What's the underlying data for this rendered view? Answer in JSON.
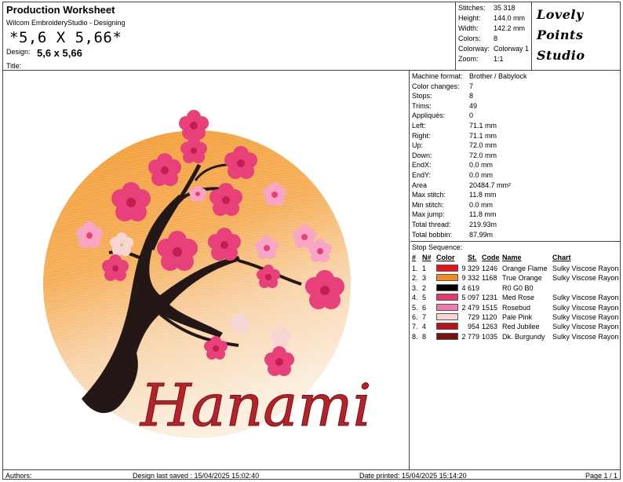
{
  "header": {
    "title": "Production Worksheet",
    "app": "Wilcom EmbroideryStudio - Designing",
    "size_text": "*5,6 X 5,66*",
    "design_label": "Design:",
    "design_value": "5,6 x 5,66",
    "title_label": "Title:"
  },
  "stats": [
    {
      "label": "Stitches:",
      "value": "35 318"
    },
    {
      "label": "Height:",
      "value": "144.0 mm"
    },
    {
      "label": "Width:",
      "value": "142.2 mm"
    },
    {
      "label": "Colors:",
      "value": "8"
    },
    {
      "label": "Colorway:",
      "value": "Colorway 1"
    },
    {
      "label": "Zoom:",
      "value": "1:1"
    }
  ],
  "logo": {
    "line1": "Lovely",
    "line2": "Points",
    "line3": "Studio"
  },
  "info": [
    {
      "label": "Machine format:",
      "value": "Brother / Babylock"
    },
    {
      "label": "Color changes:",
      "value": "7"
    },
    {
      "label": "Stops:",
      "value": "8"
    },
    {
      "label": "Trims:",
      "value": "49"
    },
    {
      "label": "Appliqués:",
      "value": "0"
    },
    {
      "label": "Left:",
      "value": "71.1 mm"
    },
    {
      "label": "Right:",
      "value": "71.1 mm"
    },
    {
      "label": "Up:",
      "value": "72.0 mm"
    },
    {
      "label": "Down:",
      "value": "72.0 mm"
    },
    {
      "label": "EndX:",
      "value": "0.0 mm"
    },
    {
      "label": "EndY:",
      "value": "0.0 mm"
    },
    {
      "label": "Area",
      "value": "20484.7 mm²"
    },
    {
      "label": "Max stitch:",
      "value": "11.8 mm"
    },
    {
      "label": "Min stitch:",
      "value": "0.0 mm"
    },
    {
      "label": "Max jump:",
      "value": "11.8 mm"
    },
    {
      "label": "Total thread:",
      "value": "219.93m"
    },
    {
      "label": "Total bobbin:",
      "value": "87.99m"
    }
  ],
  "stop_sequence": {
    "title": "Stop Sequence:",
    "headers": {
      "num": "#",
      "n": "N#",
      "color": "Color",
      "st": "St.",
      "code": "Code",
      "name": "Name",
      "chart": "Chart"
    },
    "rows": [
      {
        "num": "1.",
        "n": "1",
        "color": "#e8141b",
        "st": "9 329",
        "code": "1246",
        "name": "Orange Flame",
        "chart": "Sulky Viscose Rayon"
      },
      {
        "num": "2.",
        "n": "3",
        "color": "#f28c1a",
        "st": "9 332",
        "code": "1168",
        "name": "True Orange",
        "chart": "Sulky Viscose Rayon"
      },
      {
        "num": "3.",
        "n": "2",
        "color": "#000000",
        "st": "4 619",
        "code": "",
        "name": "R0 G0 B0",
        "chart": ""
      },
      {
        "num": "4.",
        "n": "5",
        "color": "#e8386b",
        "st": "5 097",
        "code": "1231",
        "name": "Med Rose",
        "chart": "Sulky Viscose Rayon"
      },
      {
        "num": "5.",
        "n": "6",
        "color": "#f07bb0",
        "st": "2 479",
        "code": "1515",
        "name": "Rosebud",
        "chart": "Sulky Viscose Rayon"
      },
      {
        "num": "6.",
        "n": "7",
        "color": "#f6d6d3",
        "st": "729",
        "code": "1120",
        "name": "Pale Pink",
        "chart": "Sulky Viscose Rayon"
      },
      {
        "num": "7.",
        "n": "4",
        "color": "#b5121b",
        "st": "954",
        "code": "1263",
        "name": "Red Jubilee",
        "chart": "Sulky Viscose Rayon"
      },
      {
        "num": "8.",
        "n": "8",
        "color": "#7a1010",
        "st": "2 779",
        "code": "1035",
        "name": "Dk. Burgundy",
        "chart": "Sulky Viscose Rayon"
      }
    ]
  },
  "design_image": {
    "text": "Hanami",
    "colors": {
      "sun": "#f3a13c",
      "sun_light": "#fbe6cf",
      "trunk": "#231815",
      "blossom": "#e8407a",
      "blossom_light": "#f7a6c6",
      "blossom_pale": "#f6d6d3",
      "text": "#b5232a"
    }
  },
  "footer": {
    "authors": "Authors:",
    "saved": "Design last saved : 15/04/2025 15:02:40",
    "printed": "Date printed: 15/04/2025 15:14:20",
    "page": "Page 1 / 1"
  }
}
